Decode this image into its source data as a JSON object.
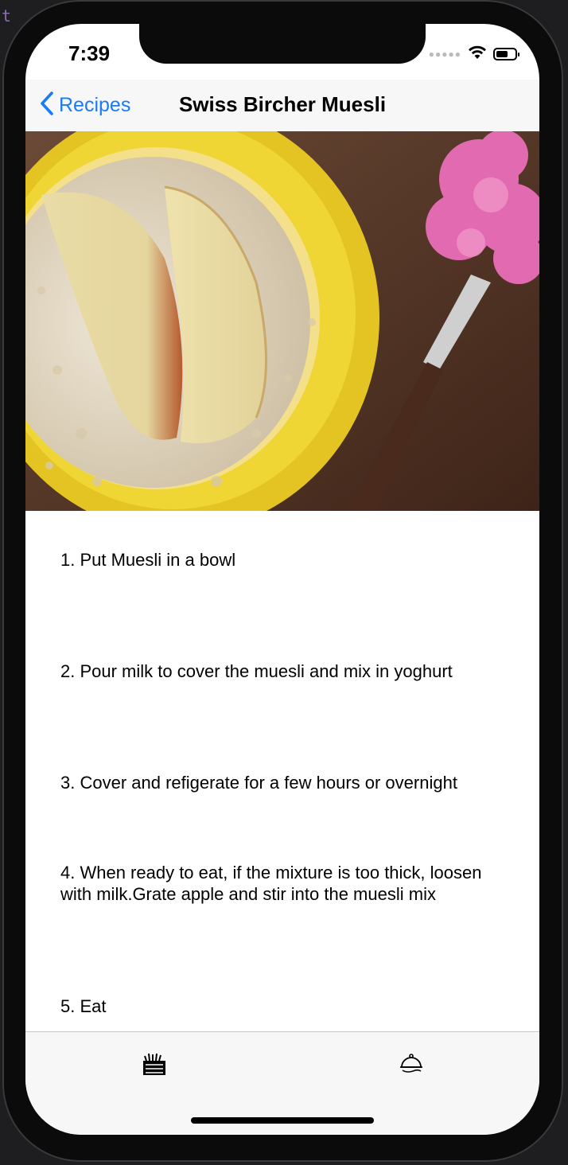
{
  "status_bar": {
    "time": "7:39"
  },
  "nav": {
    "back_label": "Recipes",
    "title": "Swiss Bircher Muesli"
  },
  "hero": {
    "image": "muesli-bowl-with-apple-slices-photo"
  },
  "steps": [
    "1.  Put Muesli in a bowl",
    "2.  Pour milk to cover the muesli and mix in yoghurt",
    "3.  Cover and refigerate for a few hours or overnight",
    "4.  When ready to eat, if the mixture is too thick, loosen with milk.Grate apple and stir into the muesli mix",
    "5.  Eat"
  ],
  "tab_bar": {
    "tabs": [
      {
        "icon": "grocery-basket-icon"
      },
      {
        "icon": "serving-cloche-icon"
      }
    ]
  },
  "colors": {
    "accent": "#1a7cf5",
    "nav_bg": "#f7f7f7",
    "frame": "#0b0b0c"
  }
}
